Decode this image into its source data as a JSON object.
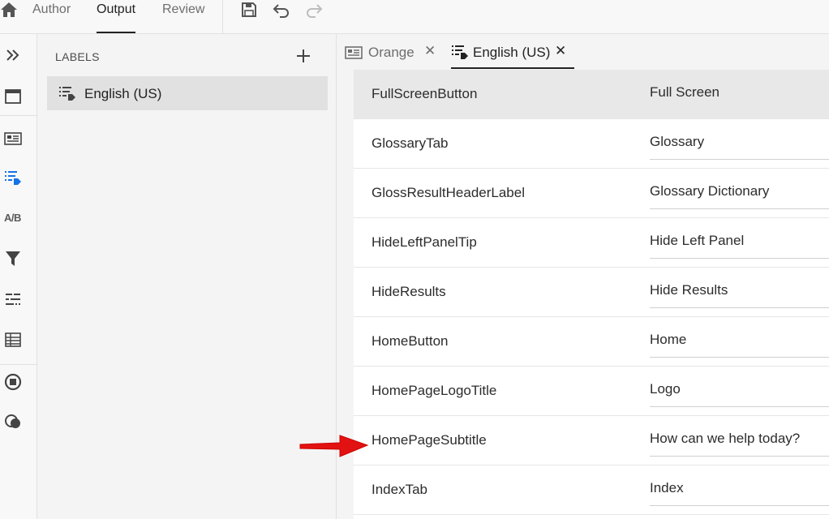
{
  "topbar": {
    "modes": [
      {
        "label": "Author"
      },
      {
        "label": "Output",
        "active": true
      },
      {
        "label": "Review"
      }
    ],
    "tools": [
      "save-icon",
      "undo-icon",
      "redo-icon"
    ]
  },
  "rail": {
    "icons": [
      "expand-icon",
      "window-icon",
      "layout-icon",
      "labels-icon",
      "ab-test-icon",
      "filter-icon",
      "properties-icon",
      "table-icon",
      "stop-icon",
      "conditions-icon"
    ],
    "ab_text": "A/B"
  },
  "labels_panel": {
    "title": "LABELS",
    "items": [
      {
        "label": "English (US)",
        "selected": true
      }
    ]
  },
  "tabs": [
    {
      "label": "Orange",
      "close": "✕",
      "active": false
    },
    {
      "label": "English (US)",
      "close": "✕",
      "active": true
    }
  ],
  "table": {
    "rows": [
      {
        "key": "FullScreenButton",
        "value": "Full Screen"
      },
      {
        "key": "GlossaryTab",
        "value": "Glossary"
      },
      {
        "key": "GlossResultHeaderLabel",
        "value": "Glossary Dictionary"
      },
      {
        "key": "HideLeftPanelTip",
        "value": "Hide Left Panel"
      },
      {
        "key": "HideResults",
        "value": "Hide Results"
      },
      {
        "key": "HomeButton",
        "value": "Home"
      },
      {
        "key": "HomePageLogoTitle",
        "value": "Logo"
      },
      {
        "key": "HomePageSubtitle",
        "value": "How can we help today?"
      },
      {
        "key": "IndexTab",
        "value": "Index"
      }
    ]
  },
  "colors": {
    "accent": "#1473e6",
    "annotation_arrow": "#e31212",
    "selected_row": "#e8e8e8"
  }
}
